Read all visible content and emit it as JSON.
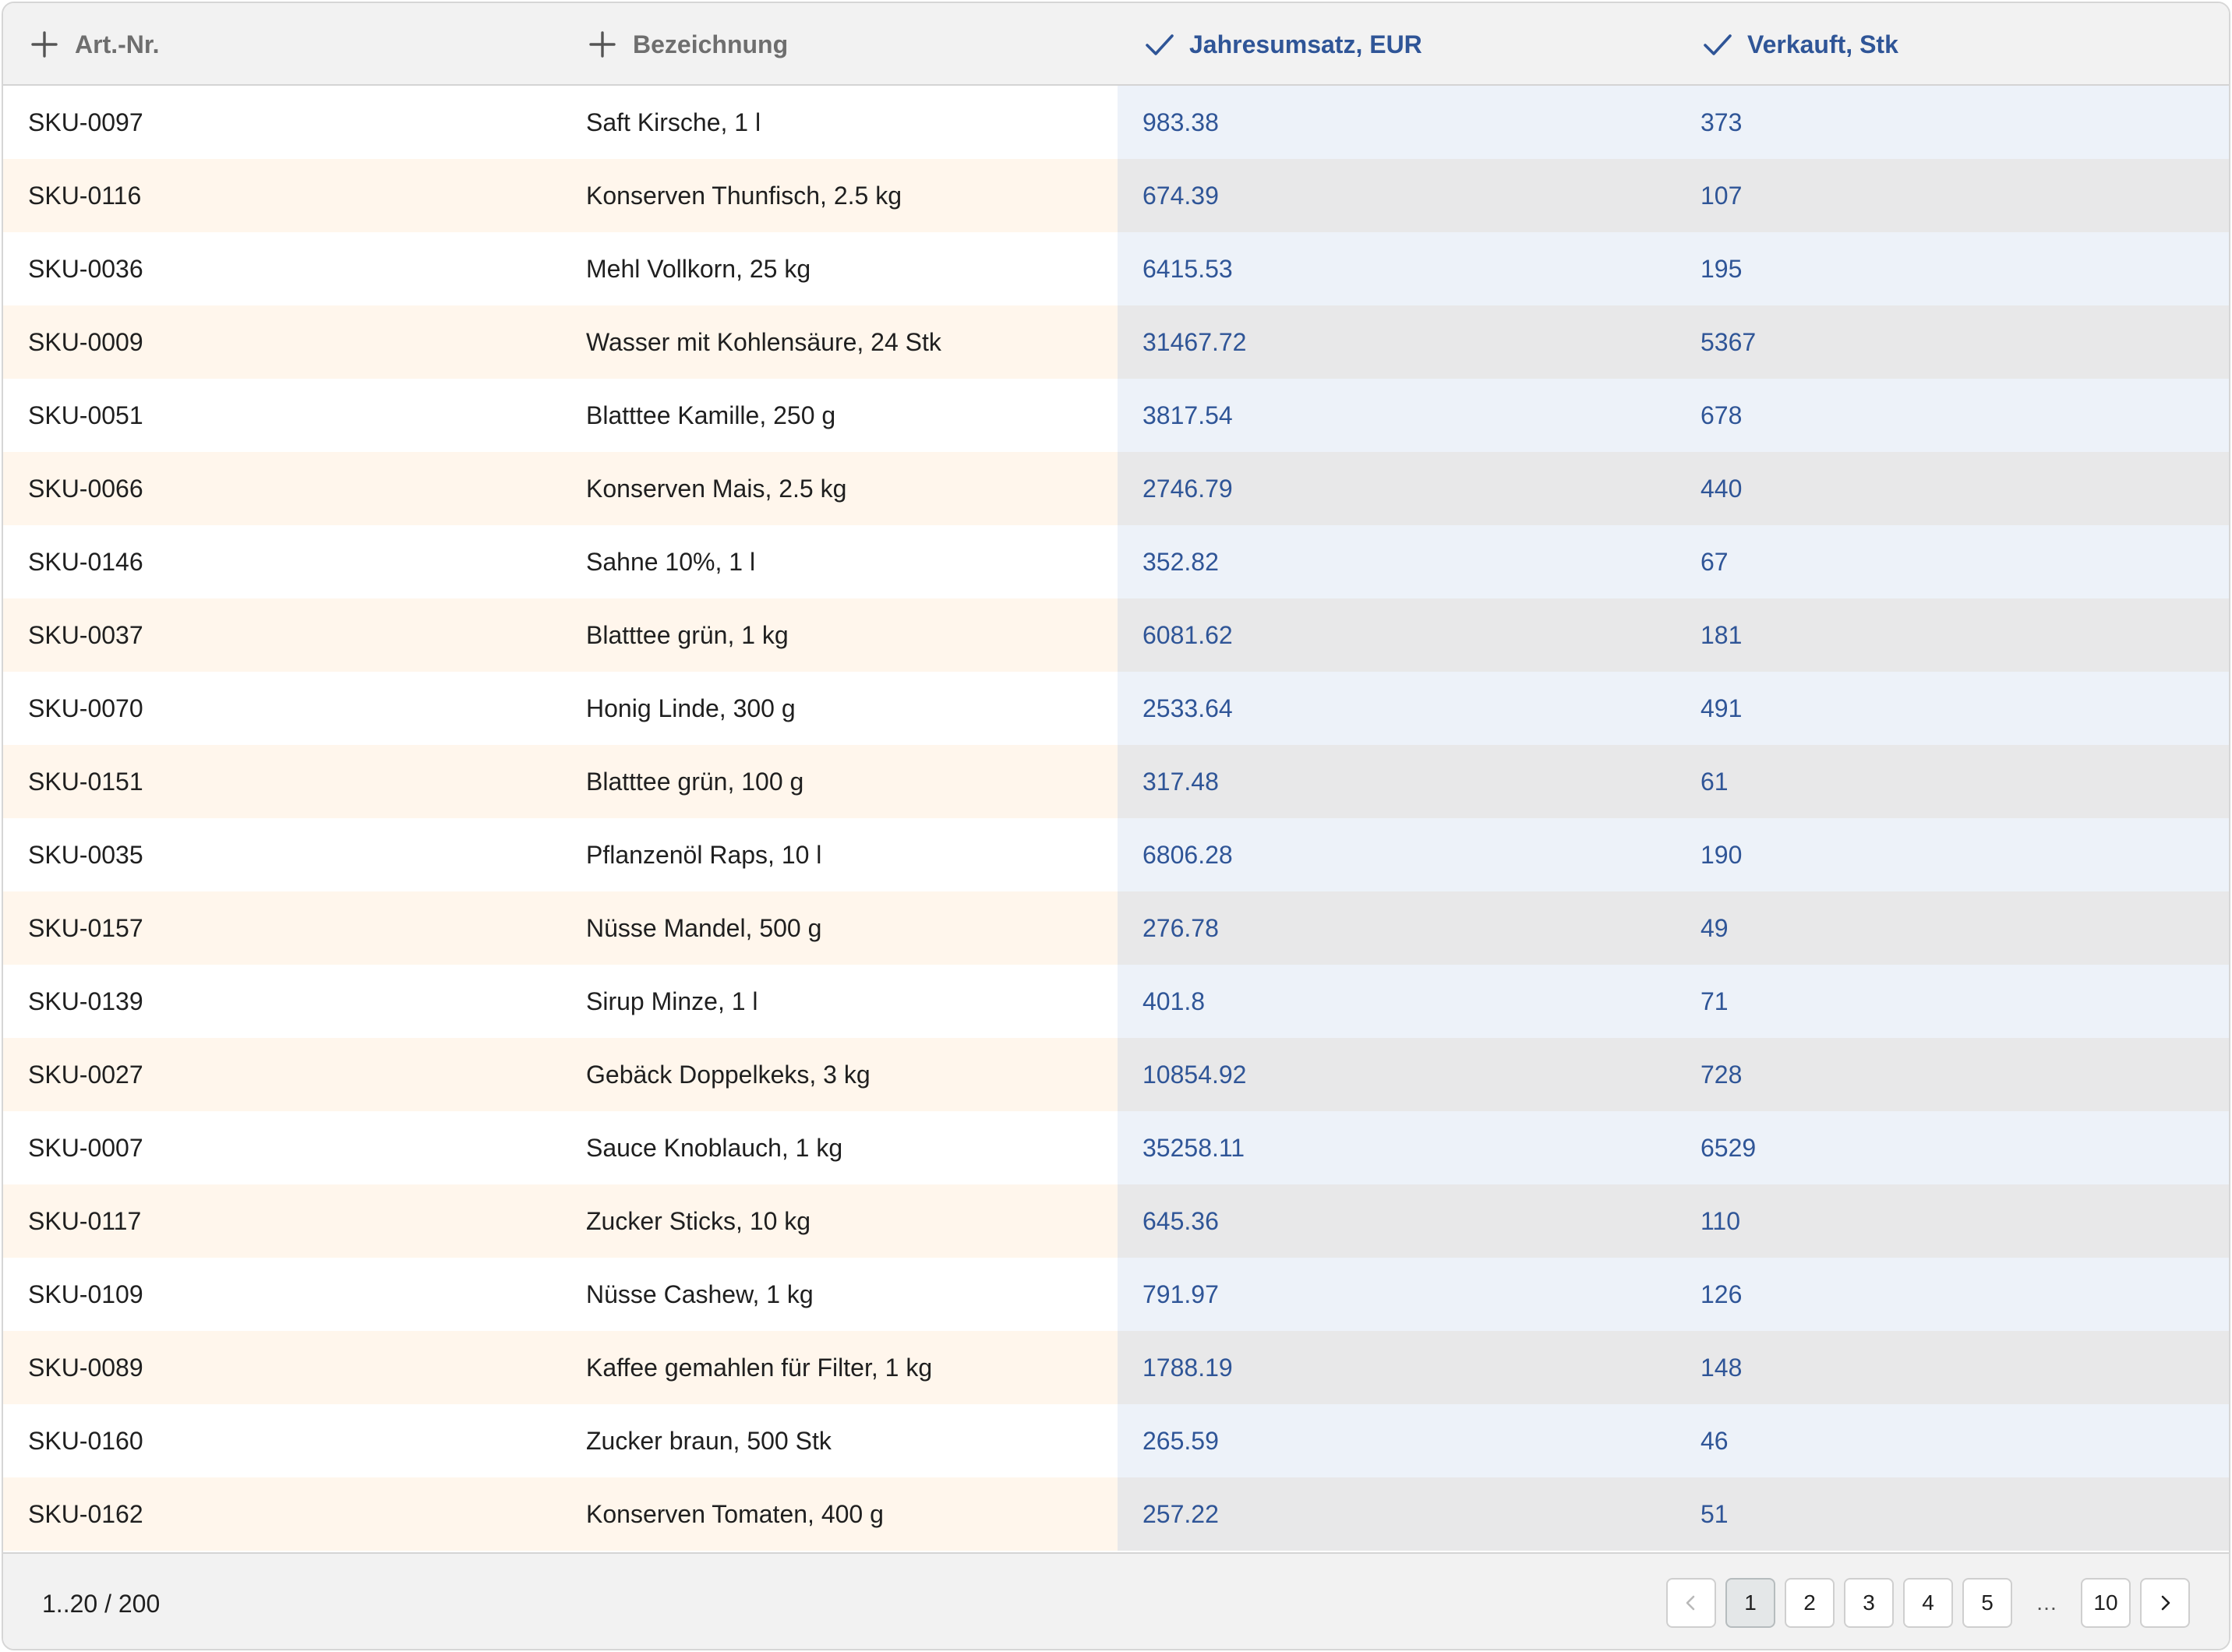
{
  "grid": {
    "columns": [
      {
        "label": "Art.-Nr.",
        "icon": "plus-icon",
        "selected": false
      },
      {
        "label": "Bezeichnung",
        "icon": "plus-icon",
        "selected": false
      },
      {
        "label": "Jahresumsatz, EUR",
        "icon": "check-icon",
        "selected": true
      },
      {
        "label": "Verkauft, Stk",
        "icon": "check-icon",
        "selected": true
      }
    ],
    "rows": [
      [
        "SKU-0097",
        "Saft Kirsche, 1 l",
        "983.38",
        "373"
      ],
      [
        "SKU-0116",
        "Konserven Thunfisch, 2.5 kg",
        "674.39",
        "107"
      ],
      [
        "SKU-0036",
        "Mehl Vollkorn, 25 kg",
        "6415.53",
        "195"
      ],
      [
        "SKU-0009",
        "Wasser mit Kohlensäure, 24 Stk",
        "31467.72",
        "5367"
      ],
      [
        "SKU-0051",
        "Blatttee Kamille, 250 g",
        "3817.54",
        "678"
      ],
      [
        "SKU-0066",
        "Konserven Mais, 2.5 kg",
        "2746.79",
        "440"
      ],
      [
        "SKU-0146",
        "Sahne 10%, 1 l",
        "352.82",
        "67"
      ],
      [
        "SKU-0037",
        "Blatttee grün, 1 kg",
        "6081.62",
        "181"
      ],
      [
        "SKU-0070",
        "Honig Linde, 300 g",
        "2533.64",
        "491"
      ],
      [
        "SKU-0151",
        "Blatttee grün, 100 g",
        "317.48",
        "61"
      ],
      [
        "SKU-0035",
        "Pflanzenöl Raps, 10 l",
        "6806.28",
        "190"
      ],
      [
        "SKU-0157",
        "Nüsse Mandel, 500 g",
        "276.78",
        "49"
      ],
      [
        "SKU-0139",
        "Sirup Minze, 1 l",
        "401.8",
        "71"
      ],
      [
        "SKU-0027",
        "Gebäck Doppelkeks, 3 kg",
        "10854.92",
        "728"
      ],
      [
        "SKU-0007",
        "Sauce Knoblauch, 1 kg",
        "35258.11",
        "6529"
      ],
      [
        "SKU-0117",
        "Zucker Sticks, 10 kg",
        "645.36",
        "110"
      ],
      [
        "SKU-0109",
        "Nüsse Cashew, 1 kg",
        "791.97",
        "126"
      ],
      [
        "SKU-0089",
        "Kaffee gemahlen für Filter, 1 kg",
        "1788.19",
        "148"
      ],
      [
        "SKU-0160",
        "Zucker braun, 500 Stk",
        "265.59",
        "46"
      ],
      [
        "SKU-0162",
        "Konserven Tomaten, 400 g",
        "257.22",
        "51"
      ]
    ]
  },
  "footer": {
    "range": "1..20 / 200",
    "pager": {
      "prev_icon": "chevron-left-icon",
      "pages": [
        "1",
        "2",
        "3",
        "4",
        "5"
      ],
      "active_page": "1",
      "ellipsis": "…",
      "last_page": "10",
      "next_icon": "chevron-right-icon"
    }
  },
  "colors": {
    "accent": "#2f5597",
    "row_even_bg": "#ffffff",
    "row_odd_bg": "#fff6ec",
    "selected_col_bg": "#edf2f9",
    "selected_col_bg_alt": "#e8e8e9",
    "header_bg": "#f2f2f2"
  }
}
